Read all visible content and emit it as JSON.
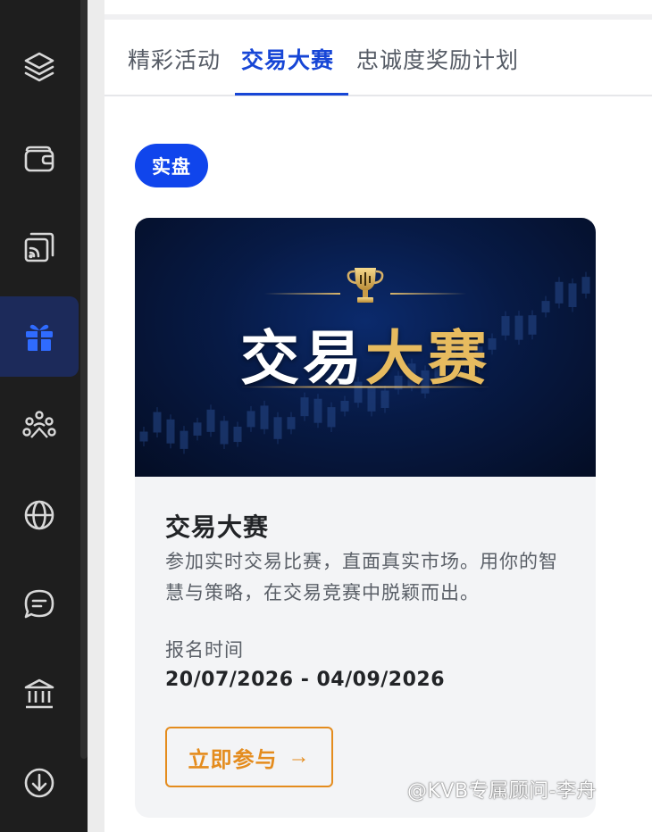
{
  "tabs": [
    {
      "label": "精彩活动",
      "active": false
    },
    {
      "label": "交易大赛",
      "active": true
    },
    {
      "label": "忠诚度奖励计划",
      "active": false
    }
  ],
  "badge": {
    "label": "实盘"
  },
  "card": {
    "banner_title_white": "交易",
    "banner_title_gold": "大赛",
    "title": "交易大赛",
    "description": "参加实时交易比赛，直面真实市场。用你的智慧与策略，在交易竞赛中脱颖而出。",
    "registration_label": "报名时间",
    "registration_dates": "20/07/2026 - 04/09/2026",
    "join_label": "立即参与",
    "join_arrow": "→"
  },
  "sidebar": {
    "items": [
      {
        "icon": "layers-icon",
        "active": false
      },
      {
        "icon": "wallet-icon",
        "active": false
      },
      {
        "icon": "copy-signal-icon",
        "active": false
      },
      {
        "icon": "gift-icon",
        "active": true
      },
      {
        "icon": "community-icon",
        "active": false
      },
      {
        "icon": "globe-icon",
        "active": false
      },
      {
        "icon": "chat-icon",
        "active": false
      },
      {
        "icon": "bank-icon",
        "active": false
      },
      {
        "icon": "download-icon",
        "active": false
      }
    ]
  },
  "watermark": {
    "text": "@KVB专属顾问-李舟"
  },
  "colors": {
    "accent_blue": "#1746d6",
    "badge_blue": "#1045ec",
    "gold": "#e7bb5f",
    "orange": "#e48c1e",
    "sidebar_bg": "#1e1e1e"
  }
}
